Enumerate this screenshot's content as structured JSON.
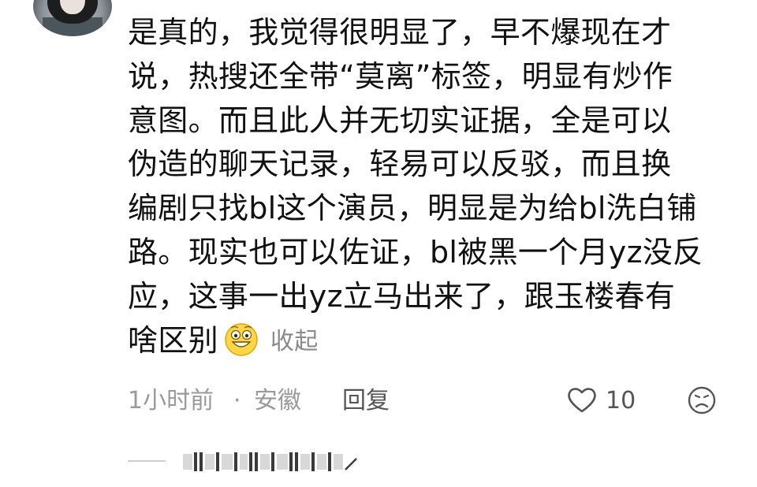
{
  "comment": {
    "lines": [
      "是真的，我觉得很明显了，早不爆现在才",
      "说，热搜还全带“莫离”标签，明显有炒作",
      "意图。而且此人并无切实证据，全是可以",
      "伪造的聊天记录，轻易可以反驳，而且换",
      "编剧只找bl这个演员，明显是为给bl洗白铺",
      "路。现实也可以佐证，bl被黑一个月yz没反",
      "应，这事一出yz立马出来了，跟玉楼春有",
      "啥区别"
    ],
    "collapse_label": "收起"
  },
  "meta": {
    "time": "1小时前",
    "separator": "·",
    "location": "安徽",
    "reply_label": "回复",
    "like_count": "10"
  },
  "icons": {
    "avatar": "avatar-image",
    "emoji": "grin-emoji-icon",
    "like": "heart-icon",
    "dislike": "sad-face-icon"
  },
  "colors": {
    "text": "#111111",
    "meta": "#9a9a9a",
    "action": "#555555"
  }
}
